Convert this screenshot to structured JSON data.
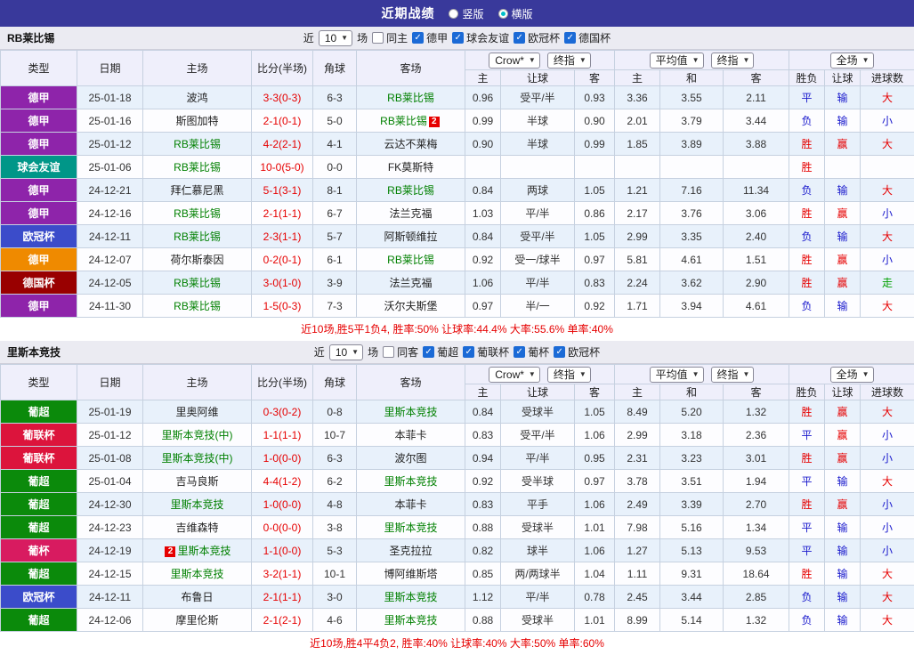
{
  "topbar": {
    "title": "近期战绩",
    "vertical": "竖版",
    "horizontal": "横版"
  },
  "ui": {
    "dropdown_arrow": "▼",
    "check": "✓"
  },
  "palette": {
    "red": "#e60000",
    "blue": "#1818cc",
    "green": "#00a000",
    "focus": "#008000"
  },
  "table_header": {
    "cols": [
      "类型",
      "日期",
      "主场",
      "比分(半场)",
      "角球",
      "客场"
    ],
    "dd": {
      "crow": "Crow*",
      "final1": "终指",
      "avg": "平均值",
      "final2": "终指",
      "full": "全场"
    },
    "sub": [
      "主",
      "让球",
      "客",
      "主",
      "和",
      "客",
      "胜负",
      "让球",
      "进球数"
    ]
  },
  "sections": [
    {
      "team": "RB莱比锡",
      "filter": {
        "near": "近",
        "count": "10",
        "games": "场",
        "same": "同主",
        "leagues": [
          "德甲",
          "球会友谊",
          "欧冠杯",
          "德国杯"
        ]
      },
      "rows": [
        {
          "league": "德甲",
          "lc": "#8e24aa",
          "date": "25-01-18",
          "home": {
            "t": "波鸿"
          },
          "score": "3-3(0-3)",
          "corner": "6-3",
          "away": {
            "t": "RB莱比锡",
            "f": true
          },
          "odds": [
            "0.96",
            "受平/半",
            "0.93",
            "3.36",
            "3.55",
            "2.11"
          ],
          "results": [
            [
              "平",
              "b"
            ],
            [
              "输",
              "b"
            ],
            [
              "大",
              "r"
            ]
          ]
        },
        {
          "league": "德甲",
          "lc": "#8e24aa",
          "date": "25-01-16",
          "home": {
            "t": "斯图加特"
          },
          "score": "2-1(0-1)",
          "corner": "5-0",
          "away": {
            "t": "RB莱比锡",
            "f": true,
            "card": "2",
            "cardpos": "post"
          },
          "odds": [
            "0.99",
            "半球",
            "0.90",
            "2.01",
            "3.79",
            "3.44"
          ],
          "results": [
            [
              "负",
              "b"
            ],
            [
              "输",
              "b"
            ],
            [
              "小",
              "b"
            ]
          ]
        },
        {
          "league": "德甲",
          "lc": "#8e24aa",
          "date": "25-01-12",
          "home": {
            "t": "RB莱比锡",
            "f": true
          },
          "score": "4-2(2-1)",
          "corner": "4-1",
          "away": {
            "t": "云达不莱梅"
          },
          "odds": [
            "0.90",
            "半球",
            "0.99",
            "1.85",
            "3.89",
            "3.88"
          ],
          "results": [
            [
              "胜",
              "r"
            ],
            [
              "赢",
              "r"
            ],
            [
              "大",
              "r"
            ]
          ]
        },
        {
          "league": "球会友谊",
          "lc": "#009688",
          "date": "25-01-06",
          "home": {
            "t": "RB莱比锡",
            "f": true
          },
          "score": "10-0(5-0)",
          "corner": "0-0",
          "away": {
            "t": "FK莫斯特"
          },
          "odds": [
            "",
            "",
            "",
            "",
            "",
            ""
          ],
          "results": [
            [
              "胜",
              "r"
            ],
            [
              "",
              ""
            ],
            [
              "",
              ""
            ]
          ]
        },
        {
          "league": "德甲",
          "lc": "#8e24aa",
          "date": "24-12-21",
          "home": {
            "t": "拜仁慕尼黑"
          },
          "score": "5-1(3-1)",
          "corner": "8-1",
          "away": {
            "t": "RB莱比锡",
            "f": true
          },
          "odds": [
            "0.84",
            "两球",
            "1.05",
            "1.21",
            "7.16",
            "11.34"
          ],
          "results": [
            [
              "负",
              "b"
            ],
            [
              "输",
              "b"
            ],
            [
              "大",
              "r"
            ]
          ]
        },
        {
          "league": "德甲",
          "lc": "#8e24aa",
          "date": "24-12-16",
          "home": {
            "t": "RB莱比锡",
            "f": true
          },
          "score": "2-1(1-1)",
          "corner": "6-7",
          "away": {
            "t": "法兰克福"
          },
          "odds": [
            "1.03",
            "平/半",
            "0.86",
            "2.17",
            "3.76",
            "3.06"
          ],
          "results": [
            [
              "胜",
              "r"
            ],
            [
              "赢",
              "r"
            ],
            [
              "小",
              "b"
            ]
          ]
        },
        {
          "league": "欧冠杯",
          "lc": "#3b4cca",
          "date": "24-12-11",
          "home": {
            "t": "RB莱比锡",
            "f": true
          },
          "score": "2-3(1-1)",
          "corner": "5-7",
          "away": {
            "t": "阿斯顿维拉"
          },
          "odds": [
            "0.84",
            "受平/半",
            "1.05",
            "2.99",
            "3.35",
            "2.40"
          ],
          "results": [
            [
              "负",
              "b"
            ],
            [
              "输",
              "b"
            ],
            [
              "大",
              "r"
            ]
          ]
        },
        {
          "league": "德甲",
          "lc": "#ef8a00",
          "date": "24-12-07",
          "home": {
            "t": "荷尔斯泰因"
          },
          "score": "0-2(0-1)",
          "corner": "6-1",
          "away": {
            "t": "RB莱比锡",
            "f": true
          },
          "odds": [
            "0.92",
            "受一/球半",
            "0.97",
            "5.81",
            "4.61",
            "1.51"
          ],
          "results": [
            [
              "胜",
              "r"
            ],
            [
              "赢",
              "r"
            ],
            [
              "小",
              "b"
            ]
          ]
        },
        {
          "league": "德国杯",
          "lc": "#990000",
          "date": "24-12-05",
          "home": {
            "t": "RB莱比锡",
            "f": true
          },
          "score": "3-0(1-0)",
          "corner": "3-9",
          "away": {
            "t": "法兰克福"
          },
          "odds": [
            "1.06",
            "平/半",
            "0.83",
            "2.24",
            "3.62",
            "2.90"
          ],
          "results": [
            [
              "胜",
              "r"
            ],
            [
              "赢",
              "r"
            ],
            [
              "走",
              "g"
            ]
          ]
        },
        {
          "league": "德甲",
          "lc": "#8e24aa",
          "date": "24-11-30",
          "home": {
            "t": "RB莱比锡",
            "f": true
          },
          "score": "1-5(0-3)",
          "corner": "7-3",
          "away": {
            "t": "沃尔夫斯堡"
          },
          "odds": [
            "0.97",
            "半/一",
            "0.92",
            "1.71",
            "3.94",
            "4.61"
          ],
          "results": [
            [
              "负",
              "b"
            ],
            [
              "输",
              "b"
            ],
            [
              "大",
              "r"
            ]
          ]
        }
      ],
      "summary": "近10场,胜5平1负4, 胜率:50% 让球率:44.4% 大率:55.6% 单率:40%"
    },
    {
      "team": "里斯本竞技",
      "filter": {
        "near": "近",
        "count": "10",
        "games": "场",
        "same": "同客",
        "leagues": [
          "葡超",
          "葡联杯",
          "葡杯",
          "欧冠杯"
        ]
      },
      "rows": [
        {
          "league": "葡超",
          "lc": "#0b8a0b",
          "date": "25-01-19",
          "home": {
            "t": "里奥阿维"
          },
          "score": "0-3(0-2)",
          "corner": "0-8",
          "away": {
            "t": "里斯本竞技",
            "f": true
          },
          "odds": [
            "0.84",
            "受球半",
            "1.05",
            "8.49",
            "5.20",
            "1.32"
          ],
          "results": [
            [
              "胜",
              "r"
            ],
            [
              "赢",
              "r"
            ],
            [
              "大",
              "r"
            ]
          ]
        },
        {
          "league": "葡联杯",
          "lc": "#dc143c",
          "date": "25-01-12",
          "home": {
            "t": "里斯本竞技(中)",
            "f": true
          },
          "score": "1-1(1-1)",
          "corner": "10-7",
          "away": {
            "t": "本菲卡"
          },
          "odds": [
            "0.83",
            "受平/半",
            "1.06",
            "2.99",
            "3.18",
            "2.36"
          ],
          "results": [
            [
              "平",
              "b"
            ],
            [
              "赢",
              "r"
            ],
            [
              "小",
              "b"
            ]
          ]
        },
        {
          "league": "葡联杯",
          "lc": "#dc143c",
          "date": "25-01-08",
          "home": {
            "t": "里斯本竞技(中)",
            "f": true
          },
          "score": "1-0(0-0)",
          "corner": "6-3",
          "away": {
            "t": "波尔图"
          },
          "odds": [
            "0.94",
            "平/半",
            "0.95",
            "2.31",
            "3.23",
            "3.01"
          ],
          "results": [
            [
              "胜",
              "r"
            ],
            [
              "赢",
              "r"
            ],
            [
              "小",
              "b"
            ]
          ]
        },
        {
          "league": "葡超",
          "lc": "#0b8a0b",
          "date": "25-01-04",
          "home": {
            "t": "吉马良斯"
          },
          "score": "4-4(1-2)",
          "corner": "6-2",
          "away": {
            "t": "里斯本竞技",
            "f": true
          },
          "odds": [
            "0.92",
            "受半球",
            "0.97",
            "3.78",
            "3.51",
            "1.94"
          ],
          "results": [
            [
              "平",
              "b"
            ],
            [
              "输",
              "b"
            ],
            [
              "大",
              "r"
            ]
          ]
        },
        {
          "league": "葡超",
          "lc": "#0b8a0b",
          "date": "24-12-30",
          "home": {
            "t": "里斯本竞技",
            "f": true
          },
          "score": "1-0(0-0)",
          "corner": "4-8",
          "away": {
            "t": "本菲卡"
          },
          "odds": [
            "0.83",
            "平手",
            "1.06",
            "2.49",
            "3.39",
            "2.70"
          ],
          "results": [
            [
              "胜",
              "r"
            ],
            [
              "赢",
              "r"
            ],
            [
              "小",
              "b"
            ]
          ]
        },
        {
          "league": "葡超",
          "lc": "#0b8a0b",
          "date": "24-12-23",
          "home": {
            "t": "吉维森特"
          },
          "score": "0-0(0-0)",
          "corner": "3-8",
          "away": {
            "t": "里斯本竞技",
            "f": true
          },
          "odds": [
            "0.88",
            "受球半",
            "1.01",
            "7.98",
            "5.16",
            "1.34"
          ],
          "results": [
            [
              "平",
              "b"
            ],
            [
              "输",
              "b"
            ],
            [
              "小",
              "b"
            ]
          ]
        },
        {
          "league": "葡杯",
          "lc": "#d81b60",
          "date": "24-12-19",
          "home": {
            "t": "里斯本竞技",
            "f": true,
            "card": "2",
            "cardpos": "pre"
          },
          "score": "1-1(0-0)",
          "corner": "5-3",
          "away": {
            "t": "圣克拉拉"
          },
          "odds": [
            "0.82",
            "球半",
            "1.06",
            "1.27",
            "5.13",
            "9.53"
          ],
          "results": [
            [
              "平",
              "b"
            ],
            [
              "输",
              "b"
            ],
            [
              "小",
              "b"
            ]
          ]
        },
        {
          "league": "葡超",
          "lc": "#0b8a0b",
          "date": "24-12-15",
          "home": {
            "t": "里斯本竞技",
            "f": true
          },
          "score": "3-2(1-1)",
          "corner": "10-1",
          "away": {
            "t": "博阿维斯塔"
          },
          "odds": [
            "0.85",
            "两/两球半",
            "1.04",
            "1.11",
            "9.31",
            "18.64"
          ],
          "results": [
            [
              "胜",
              "r"
            ],
            [
              "输",
              "b"
            ],
            [
              "大",
              "r"
            ]
          ]
        },
        {
          "league": "欧冠杯",
          "lc": "#3b4cca",
          "date": "24-12-11",
          "home": {
            "t": "布鲁日"
          },
          "score": "2-1(1-1)",
          "corner": "3-0",
          "away": {
            "t": "里斯本竞技",
            "f": true
          },
          "odds": [
            "1.12",
            "平/半",
            "0.78",
            "2.45",
            "3.44",
            "2.85"
          ],
          "results": [
            [
              "负",
              "b"
            ],
            [
              "输",
              "b"
            ],
            [
              "大",
              "r"
            ]
          ]
        },
        {
          "league": "葡超",
          "lc": "#0b8a0b",
          "date": "24-12-06",
          "home": {
            "t": "摩里伦斯"
          },
          "score": "2-1(2-1)",
          "corner": "4-6",
          "away": {
            "t": "里斯本竞技",
            "f": true
          },
          "odds": [
            "0.88",
            "受球半",
            "1.01",
            "8.99",
            "5.14",
            "1.32"
          ],
          "results": [
            [
              "负",
              "b"
            ],
            [
              "输",
              "b"
            ],
            [
              "大",
              "r"
            ]
          ]
        }
      ],
      "summary": "近10场,胜4平4负2, 胜率:40% 让球率:40% 大率:50% 单率:60%"
    }
  ]
}
